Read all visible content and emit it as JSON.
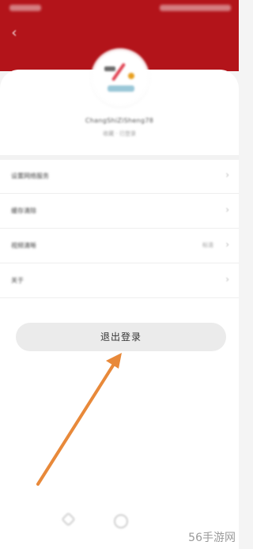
{
  "profile": {
    "username": "ChangShiZiSheng78",
    "subline": "收藏 · 已登录"
  },
  "menu": [
    {
      "label": "设置网络服务",
      "value": ""
    },
    {
      "label": "缓存清除",
      "value": ""
    },
    {
      "label": "视频清晰",
      "value": "标清"
    },
    {
      "label": "关于",
      "value": ""
    }
  ],
  "logout": {
    "label": "退出登录"
  },
  "watermark": {
    "text": "56手游网"
  },
  "colors": {
    "header": "#b3141a",
    "arrow": "#e8893a",
    "button_bg": "#ebebeb"
  },
  "icons": {
    "back": "chevron-left-icon",
    "menu_row": "chevron-right-icon"
  }
}
